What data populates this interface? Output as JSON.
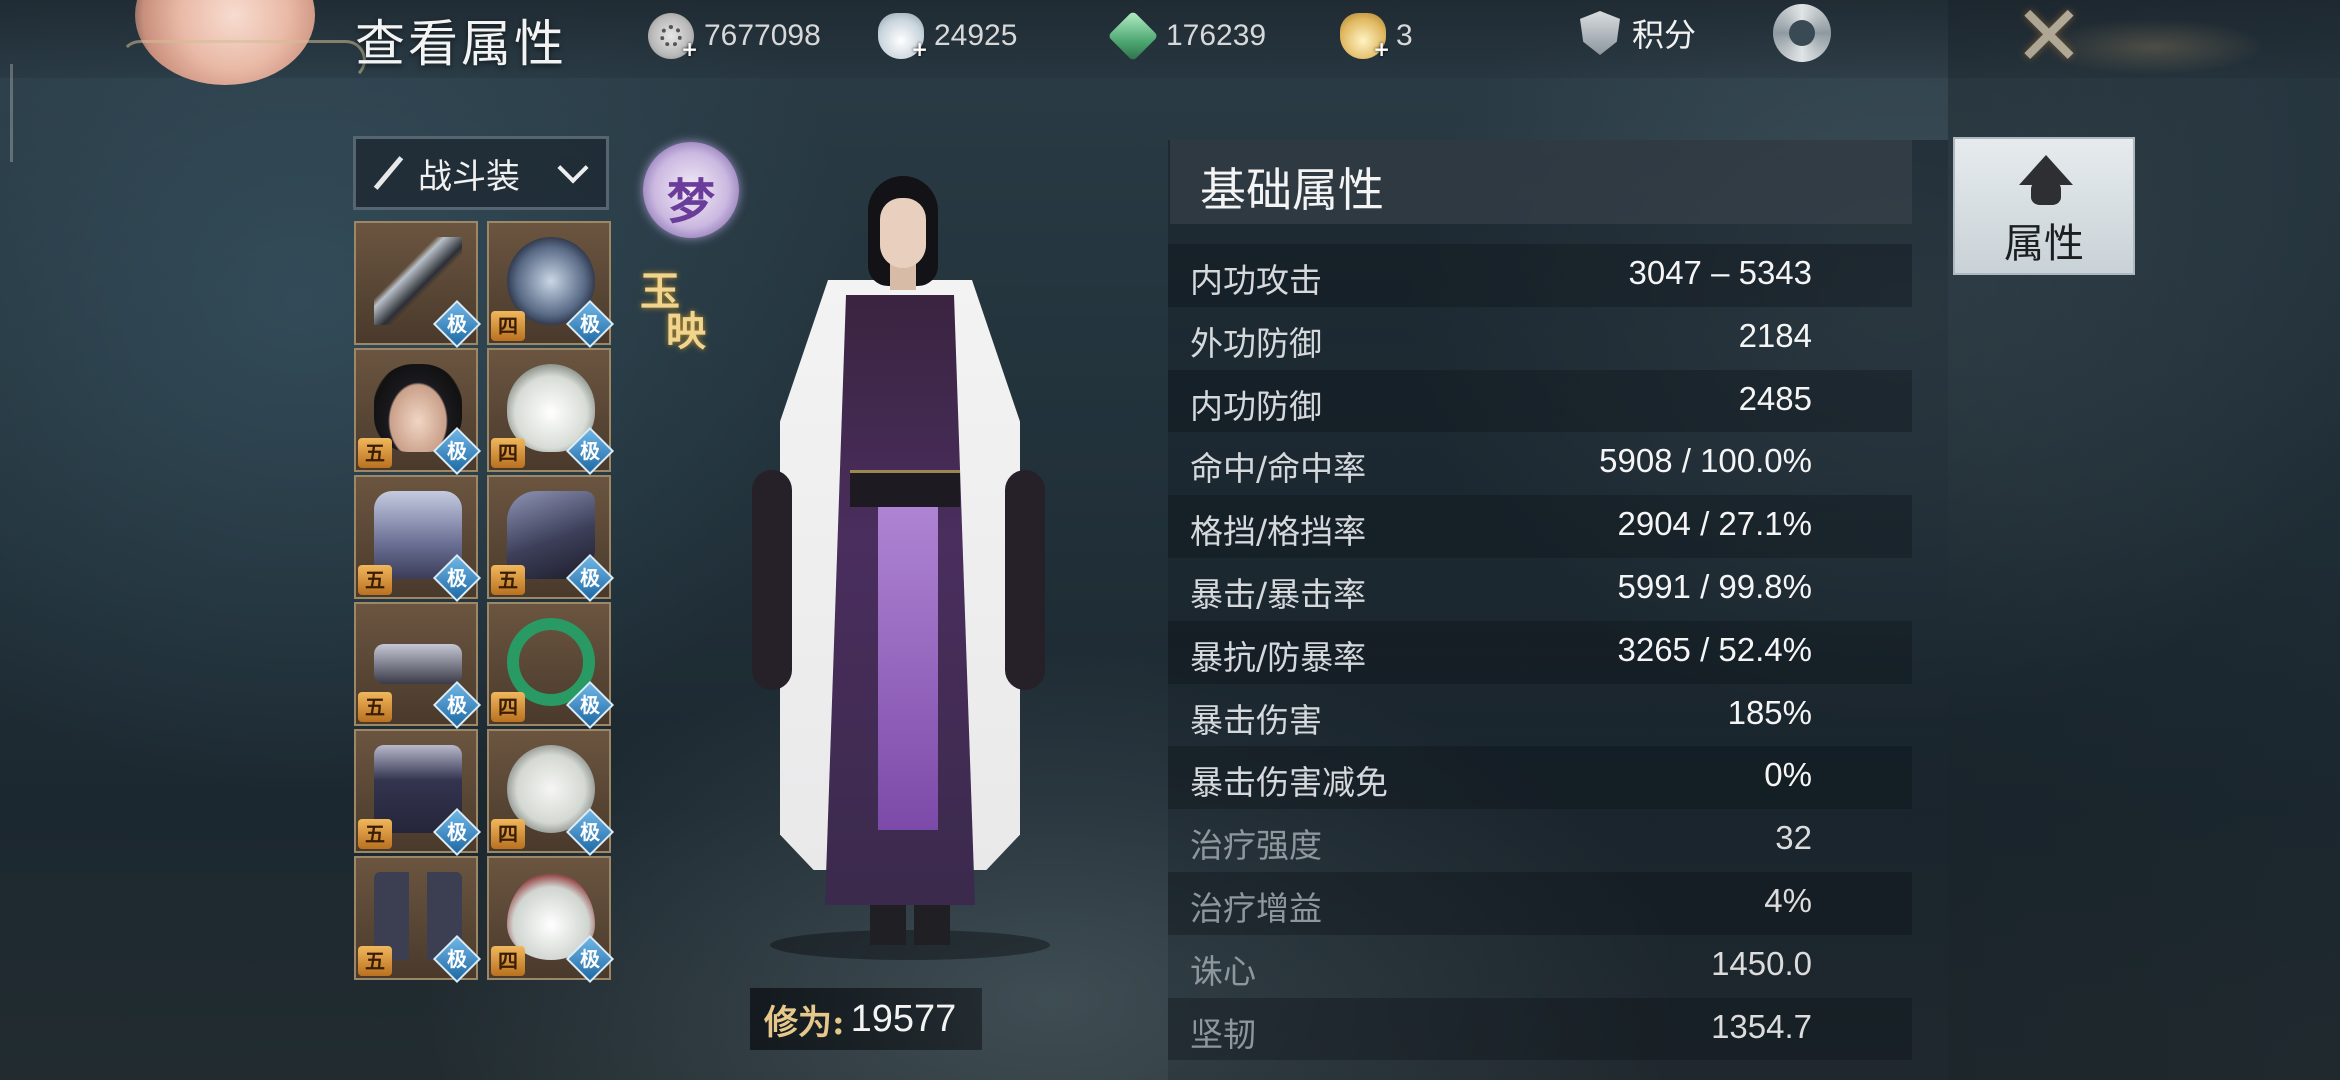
{
  "header": {
    "title": "查看属性",
    "currencies": [
      {
        "icon": "coin-icon",
        "value": "7677098"
      },
      {
        "icon": "silver-ingot-icon",
        "value": "24925"
      },
      {
        "icon": "jade-icon",
        "value": "176239"
      },
      {
        "icon": "gold-ingot-icon",
        "value": "3"
      }
    ],
    "score_label": "积分"
  },
  "outfit": {
    "selected": "战斗装"
  },
  "equipment": [
    {
      "art": "weapon",
      "tier": "",
      "rank": "极"
    },
    {
      "art": "talisman",
      "tier": "四",
      "rank": "极"
    },
    {
      "art": "face",
      "tier": "五",
      "rank": "极"
    },
    {
      "art": "lotus",
      "tier": "四",
      "rank": "极"
    },
    {
      "art": "chest",
      "tier": "五",
      "rank": "极"
    },
    {
      "art": "arm",
      "tier": "五",
      "rank": "极"
    },
    {
      "art": "belt",
      "tier": "五",
      "rank": "极"
    },
    {
      "art": "bracelet",
      "tier": "四",
      "rank": "极"
    },
    {
      "art": "pants",
      "tier": "五",
      "rank": "极"
    },
    {
      "art": "ring",
      "tier": "四",
      "rank": "极"
    },
    {
      "art": "boots",
      "tier": "五",
      "rank": "极"
    },
    {
      "art": "pendant",
      "tier": "四",
      "rank": "极"
    }
  ],
  "badges": {
    "meng": "梦",
    "yuying_1": "玉",
    "yuying_2": "映"
  },
  "cultivation": {
    "label": "修为:",
    "value": "19577"
  },
  "stats": {
    "title": "基础属性",
    "rows": [
      {
        "label": "内功攻击",
        "value": "3047 – 5343"
      },
      {
        "label": "外功防御",
        "value": "2184"
      },
      {
        "label": "内功防御",
        "value": "2485"
      },
      {
        "label": "命中/命中率",
        "value": "5908 / 100.0%"
      },
      {
        "label": "格挡/格挡率",
        "value": "2904 / 27.1%"
      },
      {
        "label": "暴击/暴击率",
        "value": "5991 / 99.8%"
      },
      {
        "label": "暴抗/防暴率",
        "value": "3265 / 52.4%"
      },
      {
        "label": "暴击伤害",
        "value": "185%"
      },
      {
        "label": "暴击伤害减免",
        "value": "0%"
      },
      {
        "label": "治疗强度",
        "value": "32"
      },
      {
        "label": "治疗增益",
        "value": "4%"
      },
      {
        "label": "诛心",
        "value": "1450.0"
      },
      {
        "label": "坚韧",
        "value": "1354.7"
      }
    ]
  },
  "side_tab": {
    "label": "属性"
  },
  "colors": {
    "tier_badge": "#d99a3c",
    "rank_badge": "#3f8fcf",
    "slot_border": "#9c8766",
    "sash": "#9b6cc6"
  }
}
